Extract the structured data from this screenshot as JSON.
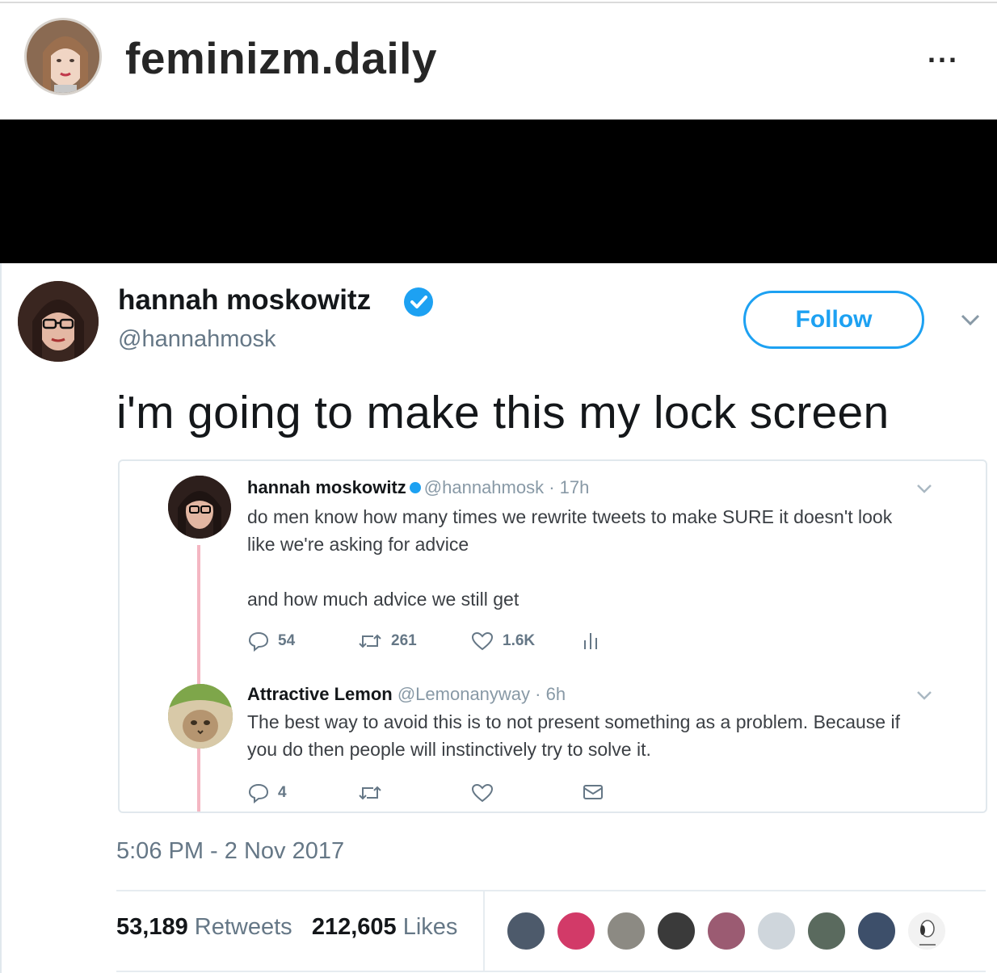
{
  "instagram": {
    "username": "feminizm.daily",
    "more_label": "..."
  },
  "tweet": {
    "author_name": "hannah moskowitz",
    "author_handle": "@hannahmosk",
    "follow_label": "Follow",
    "text": "i'm going to make this my lock screen",
    "timestamp": "5:06 PM - 2 Nov 2017",
    "retweets_count": "53,189",
    "retweets_label": "Retweets",
    "likes_count": "212,605",
    "likes_label": "Likes",
    "verified_icon": "verified-badge-icon"
  },
  "embedded": {
    "tweet1": {
      "name": "hannah moskowitz",
      "handle": "@hannahmosk",
      "time": "· 17h",
      "line1": "do men know how many times we rewrite tweets to make SURE it doesn't look",
      "line2": "like we're asking for advice",
      "line3": "and how much advice we still get",
      "replies": "54",
      "retweets": "261",
      "likes": "1.6K"
    },
    "tweet2": {
      "name": "Attractive Lemon",
      "handle": "@Lemonanyway",
      "time": "· 6h",
      "line1": "The best way to avoid this is to not present something as a problem. Because if",
      "line2": "you do then people will instinctively try to solve it.",
      "replies": "4"
    }
  },
  "colors": {
    "twitter_blue": "#1da1f2",
    "thread_line": "#f4b6c2",
    "muted_text": "#657786"
  }
}
